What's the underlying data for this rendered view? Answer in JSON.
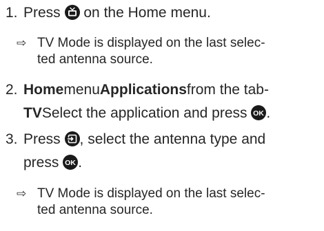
{
  "step1": {
    "number": "1.",
    "before": "Press",
    "after": "on the Home menu.",
    "icon": "tv-home-icon"
  },
  "note1": {
    "arrow": "⇨",
    "line1": "TV Mode is displayed on the last selec-",
    "line2": "ted antenna source."
  },
  "step2": {
    "number": "2.",
    "bold1": "Home",
    "text1": "menu",
    "bold2": "Applications",
    "text2": "from the tab-",
    "bold3": "TV",
    "text3": "Select the application and press",
    "end": ".",
    "icon": "ok-button-icon"
  },
  "step3": {
    "number": "3.",
    "before": "Press",
    "after": ", select the antenna type and",
    "line2": "press",
    "end": ".",
    "icons": [
      "input-source-icon",
      "ok-button-icon"
    ]
  },
  "note2": {
    "arrow": "⇨",
    "line1": "TV Mode is displayed on the last selec-",
    "line2": "ted antenna source."
  },
  "icon_labels": {
    "ok": "OK"
  },
  "colors": {
    "text": "#262626",
    "icon": "#1a1a1a"
  }
}
